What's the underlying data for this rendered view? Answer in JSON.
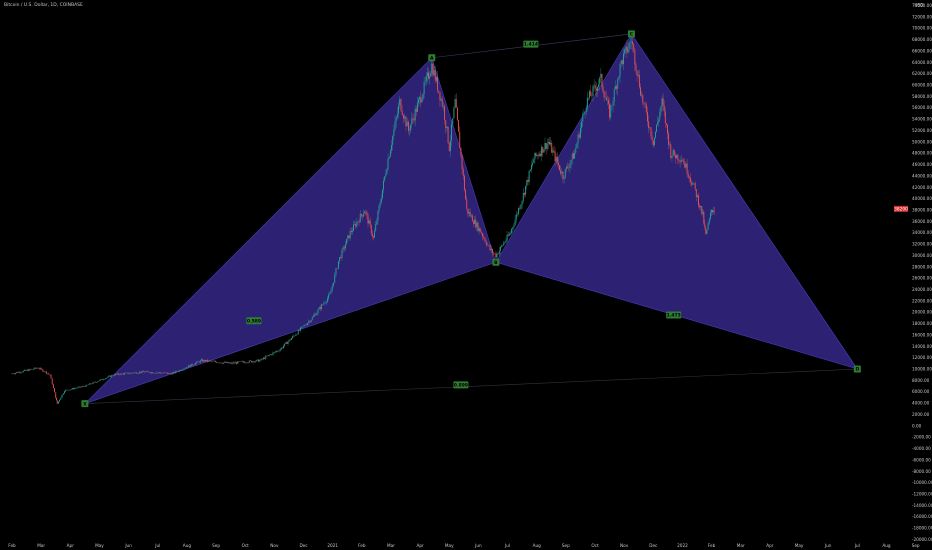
{
  "symbol_title": "Bitcoin / U.S. Dollar, 1D, COINBASE",
  "currency": "USD",
  "current_price_label": "38200",
  "colors": {
    "background": "#000000",
    "pattern_fill": "#2f2379",
    "pattern_edge": "#4a3cc0",
    "label_bg": "#2e7d32",
    "candle_up": "#26a69a",
    "candle_down": "#ef5350",
    "price_tag": "#d32f2f"
  },
  "chart_data": {
    "type": "candlestick-harmonic",
    "title": "Bitcoin / U.S. Dollar, 1D, COINBASE",
    "y_axis_ticks": [
      "74000.00",
      "72000.00",
      "70000.00",
      "68000.00",
      "66000.00",
      "64000.00",
      "62000.00",
      "60000.00",
      "58000.00",
      "56000.00",
      "54000.00",
      "52000.00",
      "50000.00",
      "48000.00",
      "46000.00",
      "44000.00",
      "42000.00",
      "40000.00",
      "38000.00",
      "36000.00",
      "34000.00",
      "32000.00",
      "30000.00",
      "28000.00",
      "26000.00",
      "24000.00",
      "22000.00",
      "20000.00",
      "18000.00",
      "16000.00",
      "14000.00",
      "12000.00",
      "10000.00",
      "8000.00",
      "6000.00",
      "4000.00",
      "2000.00",
      "0.00",
      "-2000.00",
      "-4000.00",
      "-6000.00",
      "-8000.00",
      "-10000.00",
      "-12000.00",
      "-14000.00",
      "-16000.00",
      "-18000.00",
      "-20000.00"
    ],
    "x_axis_ticks": [
      "Feb",
      "Mar",
      "Apr",
      "May",
      "Jun",
      "Jul",
      "Aug",
      "Sep",
      "Oct",
      "Nov",
      "Dec",
      "2021",
      "Feb",
      "Mar",
      "Apr",
      "May",
      "Jun",
      "Jul",
      "Aug",
      "Sep",
      "Oct",
      "Nov",
      "Dec",
      "2022",
      "Feb",
      "Mar",
      "Apr",
      "May",
      "Jun",
      "Jul",
      "Aug",
      "Sep"
    ],
    "ylim": [
      -21000,
      75000
    ],
    "pattern_points": [
      {
        "label": "X",
        "month": 2.5,
        "price": 3900
      },
      {
        "label": "A",
        "month": 14.4,
        "price": 64800
      },
      {
        "label": "B",
        "month": 16.6,
        "price": 28800
      },
      {
        "label": "C",
        "month": 21.25,
        "price": 69000
      },
      {
        "label": "D",
        "month": 29.0,
        "price": 10000
      }
    ],
    "ratios": [
      {
        "value": "0.589",
        "month": 8.3,
        "price": 18500
      },
      {
        "value": "1.414",
        "month": 17.8,
        "price": 67200
      },
      {
        "value": "1.473",
        "month": 22.7,
        "price": 19500
      },
      {
        "value": "0.899",
        "month": 15.4,
        "price": 7200
      }
    ],
    "price_path": [
      [
        0,
        9200
      ],
      [
        0.9,
        10200
      ],
      [
        1.3,
        9000
      ],
      [
        1.5,
        5000
      ],
      [
        1.55,
        3900
      ],
      [
        1.8,
        6200
      ],
      [
        2.5,
        7000
      ],
      [
        3.5,
        9000
      ],
      [
        4.5,
        9500
      ],
      [
        5.5,
        9200
      ],
      [
        6.5,
        11500
      ],
      [
        7.5,
        11000
      ],
      [
        8.5,
        11500
      ],
      [
        9.2,
        13500
      ],
      [
        9.7,
        16000
      ],
      [
        10.3,
        19000
      ],
      [
        10.9,
        23000
      ],
      [
        11.2,
        29000
      ],
      [
        11.6,
        34000
      ],
      [
        12.1,
        38000
      ],
      [
        12.4,
        33000
      ],
      [
        12.9,
        47000
      ],
      [
        13.3,
        57000
      ],
      [
        13.6,
        52000
      ],
      [
        14.1,
        59000
      ],
      [
        14.4,
        63500
      ],
      [
        14.8,
        56000
      ],
      [
        15.0,
        49000
      ],
      [
        15.2,
        57000
      ],
      [
        15.6,
        38000
      ],
      [
        16.1,
        34000
      ],
      [
        16.4,
        31000
      ],
      [
        16.6,
        30000
      ],
      [
        17.1,
        34000
      ],
      [
        17.5,
        40000
      ],
      [
        17.9,
        47000
      ],
      [
        18.4,
        50000
      ],
      [
        18.9,
        44000
      ],
      [
        19.3,
        48000
      ],
      [
        19.7,
        57000
      ],
      [
        20.2,
        61000
      ],
      [
        20.5,
        55000
      ],
      [
        20.9,
        64000
      ],
      [
        21.25,
        68000
      ],
      [
        21.6,
        58000
      ],
      [
        22.0,
        50000
      ],
      [
        22.3,
        57000
      ],
      [
        22.6,
        48000
      ],
      [
        23.0,
        47000
      ],
      [
        23.4,
        42000
      ],
      [
        23.7,
        37000
      ],
      [
        23.8,
        33500
      ],
      [
        24.0,
        38000
      ],
      [
        24.1,
        38200
      ]
    ]
  }
}
